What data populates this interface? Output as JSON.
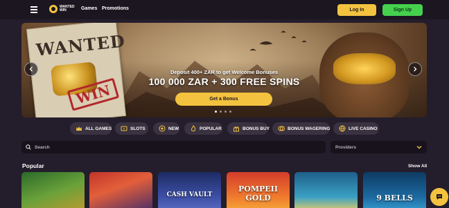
{
  "header": {
    "logo_text": "WANTED WIN",
    "nav": [
      {
        "label": "Games"
      },
      {
        "label": "Promotions"
      }
    ],
    "login_label": "Log In",
    "signup_label": "Sign Up"
  },
  "banner": {
    "poster_title": "WANTED",
    "poster_stamp": "WIN",
    "subtitle": "Deposit 400+ ZAR to get Welcome Bonuses",
    "headline": "100 000 ZAR + 300 FREE SPINS",
    "cta_label": "Get a Bonus",
    "slide_count": 4,
    "active_slide": 1
  },
  "categories": [
    {
      "label": "ALL GAMES",
      "icon": "crown-icon"
    },
    {
      "label": "SLOTS",
      "icon": "slots-icon"
    },
    {
      "label": "NEW",
      "icon": "new-icon"
    },
    {
      "label": "POPULAR",
      "icon": "fire-icon"
    },
    {
      "label": "BONUS BUY",
      "icon": "gift-icon"
    },
    {
      "label": "BONUS WAGERING",
      "icon": "coins-icon"
    },
    {
      "label": "LIVE CASINO",
      "icon": "globe-icon"
    }
  ],
  "search": {
    "placeholder": "Search",
    "providers_label": "Providers"
  },
  "popular": {
    "title": "Popular",
    "show_all_label": "Show All",
    "games": [
      {
        "title": ""
      },
      {
        "title": ""
      },
      {
        "title": "CASH VAULT"
      },
      {
        "title": "POMPEII GOLD"
      },
      {
        "title": ""
      },
      {
        "title": "9 BELLS"
      }
    ]
  },
  "colors": {
    "background": "#241d2b",
    "header": "#1b1620",
    "accent_yellow": "#f3c33f",
    "accent_green": "#45d14e",
    "chip": "#3a3240"
  }
}
